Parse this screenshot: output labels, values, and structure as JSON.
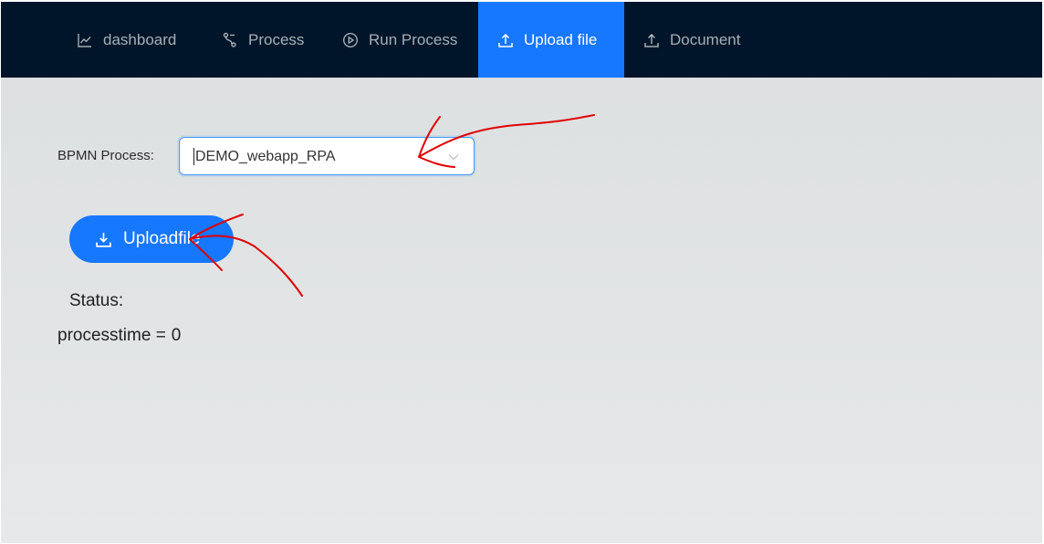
{
  "nav": {
    "items": [
      {
        "label": "dashboard",
        "icon": "line-chart-icon"
      },
      {
        "label": "Process",
        "icon": "branches-icon"
      },
      {
        "label": "Run Process",
        "icon": "play-circle-icon"
      },
      {
        "label": "Upload file",
        "icon": "upload-icon",
        "active": true
      },
      {
        "label": "Document",
        "icon": "upload-icon"
      }
    ],
    "active_color": "#1677ff",
    "background": "#001529"
  },
  "form": {
    "process_label": "BPMN Process:",
    "process_value": "DEMO_webapp_RPA"
  },
  "upload_button": {
    "label": "Uploadfile",
    "icon": "download-icon"
  },
  "status": {
    "label": "Status:",
    "processtime_label": "processtime =",
    "processtime_value": "0"
  },
  "annotation_color": "#e00000"
}
